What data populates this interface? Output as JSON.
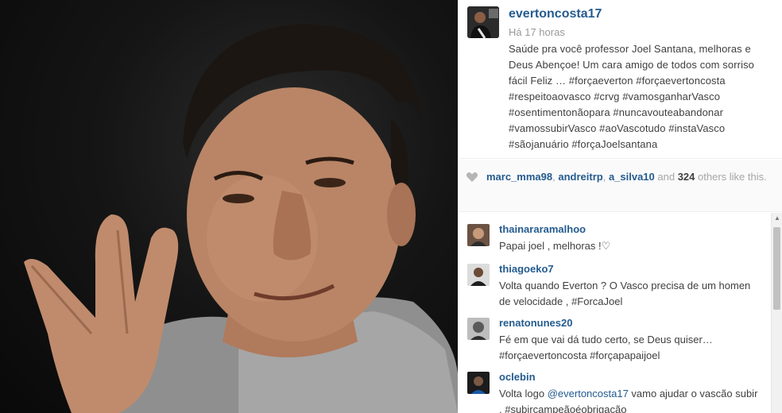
{
  "post": {
    "username": "evertoncosta17",
    "time": "Há 17 horas",
    "caption": "Saúde pra você professor Joel Santana, melhoras e Deus Abençoe! Um cara amigo de todos com sorriso fácil Feliz … #forçaeverton #forçaevertoncosta #respeitoaovasco #crvg #vamosganharVasco #osentimentonãopara #nuncavouteabandonar #vamossubirVasco #aoVascotudo #instaVasco #sãojanuário #forçaJoelsantana"
  },
  "likes": {
    "user1": "marc_mma98",
    "sep1": ", ",
    "user2": "andreitrp",
    "sep2": ", ",
    "user3": "a_silva10",
    "and": " and ",
    "count": "324",
    "suffix": " others like this."
  },
  "comments": [
    {
      "user": "thainararamalhoo",
      "text": "Papai joel , melhoras !♡"
    },
    {
      "user": "thiagoeko7",
      "text": "Volta quando Everton ? O Vasco precisa de um homen de velocidade , #ForcaJoel"
    },
    {
      "user": "renatonunes20",
      "text": "Fé em que vai dá tudo certo, se Deus quiser… #forçaevertoncosta #forçapapaijoel"
    },
    {
      "user": "oclebin",
      "text_prefix": "Volta logo ",
      "mention": "@evertoncosta17",
      "text_suffix": " vamo ajudar o vascão subir . #subircampeãoéobrigação"
    }
  ],
  "icons": {
    "heart": "heart-icon",
    "scroll_up": "scroll-up-icon"
  },
  "colors": {
    "link": "#245b8f",
    "text": "#3f3f3f",
    "muted": "#999999"
  }
}
